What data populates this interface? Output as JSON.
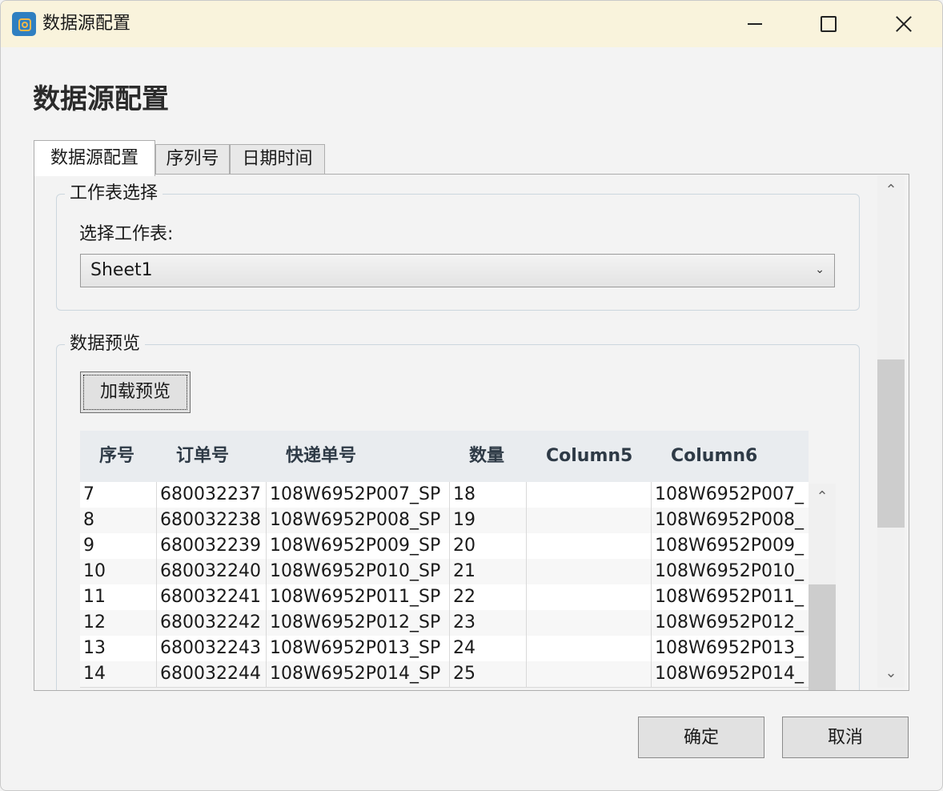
{
  "window": {
    "title": "数据源配置",
    "controls": {
      "minimize": "minimize-icon",
      "maximize": "maximize-icon",
      "close": "close-icon"
    }
  },
  "page": {
    "heading": "数据源配置"
  },
  "tabs": [
    {
      "label": "数据源配置",
      "active": true
    },
    {
      "label": "序列号",
      "active": false
    },
    {
      "label": "日期时间",
      "active": false
    }
  ],
  "sheet_group": {
    "legend": "工作表选择",
    "field_label": "选择工作表:",
    "selected_sheet": "Sheet1"
  },
  "preview_group": {
    "legend": "数据预览",
    "load_button": "加载预览"
  },
  "table": {
    "columns": [
      "序号",
      "订单号",
      "快递单号",
      "数量",
      "Column5",
      "Column6"
    ],
    "rows": [
      [
        "7",
        "680032237",
        "108W6952P007_SP",
        "18",
        "",
        "108W6952P007_"
      ],
      [
        "8",
        "680032238",
        "108W6952P008_SP",
        "19",
        "",
        "108W6952P008_"
      ],
      [
        "9",
        "680032239",
        "108W6952P009_SP",
        "20",
        "",
        "108W6952P009_"
      ],
      [
        "10",
        "680032240",
        "108W6952P010_SP",
        "21",
        "",
        "108W6952P010_"
      ],
      [
        "11",
        "680032241",
        "108W6952P011_SP",
        "22",
        "",
        "108W6952P011_"
      ],
      [
        "12",
        "680032242",
        "108W6952P012_SP",
        "23",
        "",
        "108W6952P012_"
      ],
      [
        "13",
        "680032243",
        "108W6952P013_SP",
        "24",
        "",
        "108W6952P013_"
      ],
      [
        "14",
        "680032244",
        "108W6952P014_SP",
        "25",
        "",
        "108W6952P014_"
      ]
    ]
  },
  "footer": {
    "ok": "确定",
    "cancel": "取消"
  },
  "colors": {
    "titlebar": "#f9f3dc",
    "header_bg": "#e9ecef",
    "header_text": "#2e3a46",
    "app_icon": "#2f7fc1"
  }
}
